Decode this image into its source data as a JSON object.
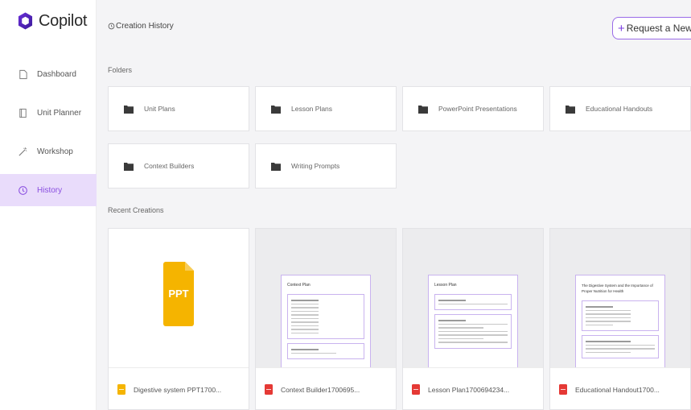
{
  "app": {
    "title": "Copilot",
    "accent": "#8a4fe0"
  },
  "sidebar": {
    "items": [
      {
        "label": "Dashboard",
        "icon": "document-icon",
        "active": false
      },
      {
        "label": "Unit Planner",
        "icon": "book-icon",
        "active": false
      },
      {
        "label": "Workshop",
        "icon": "wand-icon",
        "active": false
      },
      {
        "label": "History",
        "icon": "clock-icon",
        "active": true
      }
    ]
  },
  "header": {
    "breadcrumb": "Creation History",
    "request_button": "Request a New Tool"
  },
  "folders": {
    "label": "Folders",
    "items": [
      "Unit Plans",
      "Lesson Plans",
      "PowerPoint Presentations",
      "Educational Handouts",
      "Context Builders",
      "Writing Prompts"
    ]
  },
  "recent": {
    "label": "Recent Creations",
    "items": [
      {
        "name": "Digestive system PPT1700...",
        "type": "ppt",
        "preview_title": "",
        "big_label": "PPT"
      },
      {
        "name": "Context Builder1700695...",
        "type": "pdf",
        "preview_title": "Context Plan"
      },
      {
        "name": "Lesson Plan1700694234...",
        "type": "pdf",
        "preview_title": "Lesson Plan"
      },
      {
        "name": "Educational Handout1700...",
        "type": "pdf",
        "preview_title": "The Digestive System and the Importance of Proper Nutrition for Health"
      }
    ]
  }
}
